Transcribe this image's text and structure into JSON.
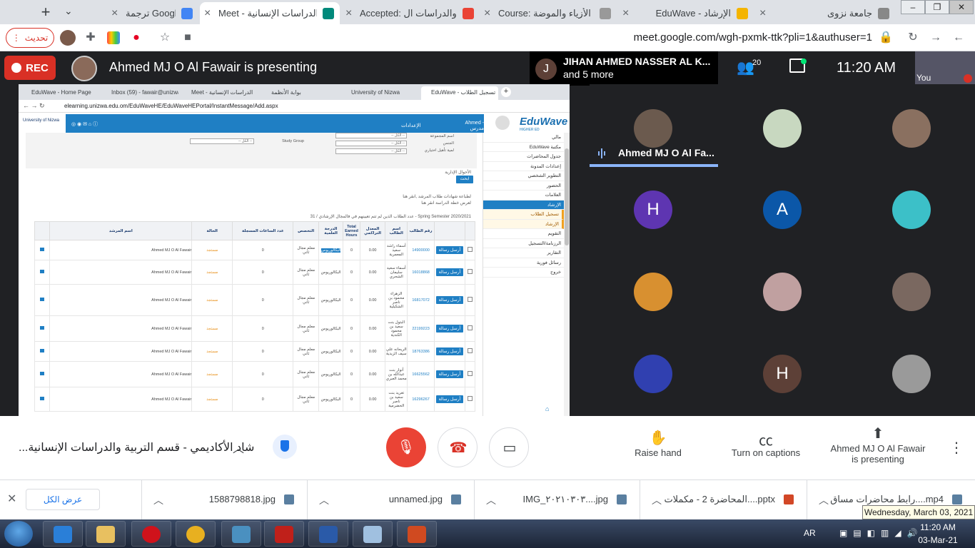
{
  "browser": {
    "tabs": [
      {
        "title": "ترجمة Google",
        "icon": "google-translate-icon",
        "active": false
      },
      {
        "title": "Meet - الدراسات الإنسانية",
        "icon": "google-meet-icon",
        "active": true
      },
      {
        "title": "Accepted: التربية والدراسات ال",
        "icon": "gmail-icon",
        "active": false
      },
      {
        "title": "Course: ملات الأزياء والموضة",
        "icon": "moodle-icon",
        "active": false
      },
      {
        "title": "EduWave - الإرشاد",
        "icon": "eduwave-icon",
        "active": false
      },
      {
        "title": "جامعة نزوى",
        "icon": "university-icon",
        "active": false
      }
    ],
    "update_label": "تحديث",
    "url": "meet.google.com/wgh-pxmk-ttk?pli=1&authuser=1"
  },
  "meet": {
    "rec_label": "REC",
    "presenting_text": "Ahmed MJ O Al Fawair is presenting",
    "notification": {
      "initial": "J",
      "name": "JIHAN AHMED NASSER AL K...",
      "more": "and 5 more"
    },
    "participant_count": "20",
    "time": "11:20 AM",
    "self_label": "You",
    "meeting_title": "...شاد الأكاديمي - قسم التربية والدراسات الإنسانية",
    "speaker_name": "Ahmed MJ O Al Fa...",
    "tiles": [
      {
        "type": "photo",
        "color": "#6b5a4e"
      },
      {
        "type": "photo",
        "color": "#c8d8c0"
      },
      {
        "type": "photo",
        "color": "#8a7060"
      },
      {
        "type": "letter",
        "letter": "H",
        "color": "#5e35b1"
      },
      {
        "type": "letter",
        "letter": "A",
        "color": "#0b57a8"
      },
      {
        "type": "photo",
        "color": "#3cc0c8"
      },
      {
        "type": "photo",
        "color": "#d89030"
      },
      {
        "type": "photo",
        "color": "#c0a0a0"
      },
      {
        "type": "photo",
        "color": "#7a6860"
      },
      {
        "type": "photo",
        "color": "#3040b0"
      },
      {
        "type": "letter",
        "letter": "H",
        "color": "#5d4037"
      },
      {
        "type": "photo",
        "color": "#9a9a9a"
      }
    ],
    "controls": {
      "raise_hand": "Raise hand",
      "captions": "Turn on captions",
      "presenting_line1": "Ahmed MJ O Al Fawair",
      "presenting_line2": "is presenting"
    }
  },
  "presented": {
    "tabs": [
      "EduWave - Home Page",
      "Inbox (59) - fawair@unizwa",
      "Meet - الدراسات الإنسانية",
      "بوابة الأنظمة",
      "University of Nizwa",
      "EduWave - تسجيل الطلاب"
    ],
    "url": "elearning.unizwa.edu.om/EduWaveHE/EduWaveHEPortal/InstantMessage/Add.aspx",
    "header_right": "Ahmed - مدرس",
    "header_settings": "الإعدادات",
    "logo_left": "University of Nizwa",
    "logo": "EduWave",
    "logo_sub": "HIGHER ED",
    "sidebar": [
      {
        "label": "مالي",
        "state": "normal"
      },
      {
        "label": "EduWave مكتبة",
        "state": "chev"
      },
      {
        "label": "جدول المحاضرات",
        "state": "normal"
      },
      {
        "label": "إعدادات المدونة",
        "state": "chev"
      },
      {
        "label": "التطوير الشخصي",
        "state": "normal"
      },
      {
        "label": "الحضور",
        "state": "normal"
      },
      {
        "label": "العلامات",
        "state": "normal"
      },
      {
        "label": "الإرشاد",
        "state": "on"
      },
      {
        "label": "تسجيل الطلاب",
        "state": "sub"
      },
      {
        "label": "الإرشاد",
        "state": "sub"
      },
      {
        "label": "التقويم",
        "state": "normal"
      },
      {
        "label": "الرزنامة/التسجيل",
        "state": "normal"
      },
      {
        "label": "التقارير",
        "state": "chev"
      },
      {
        "label": "رسائل فورية",
        "state": "chev"
      },
      {
        "label": "خروج",
        "state": "normal"
      }
    ],
    "filters": {
      "study_group": "Study Group",
      "labels": [
        "اسم المجموعة",
        "الجنس",
        "لمية تأهيل اختياري"
      ],
      "select_placeholder": "-- الكل --"
    },
    "search_label": "ابحث",
    "note_top": "الأحوال الإدارية",
    "note1": "لطباعة شهادات طلاب المرشد ,انقر هنا",
    "note2": "لعرض خطة الدراسة انقر هنا",
    "summary": "عدد الطلاب الذين لم تتم تعيينهم في فالمجال الإرشادي / 31 - Spring Semester 2020/2021",
    "table": {
      "headers": [
        "",
        "",
        "رقم الطالب",
        "اسم الطالب",
        "المعدل التراكمي",
        "Total Earned Hours",
        "الدرجة العلمية",
        "التخصص",
        "عدد الساعات المسجلة",
        "الحالة",
        "اسم المرشد",
        ""
      ],
      "send_label": "أرسل رسالة",
      "rows": [
        {
          "id": "14900000",
          "name": "أسماء راشد سعيد المعمرية",
          "gpa": "0.00",
          "hours": "0",
          "degree": "البكالوريوس",
          "major": "معلم مجال ثاني",
          "reg": "0",
          "status": "مستجد",
          "advisor": "Ahmed MJ O Al Fawair"
        },
        {
          "id": "16018868",
          "name": "أسماء سعيد سليمان الشحري",
          "gpa": "0.00",
          "hours": "0",
          "degree": "البكالوريوس",
          "major": "معلم مجال ثاني",
          "reg": "0",
          "status": "مستجد",
          "advisor": "Ahmed MJ O Al Fawair"
        },
        {
          "id": "16817072",
          "name": "الزهراء محمود بن ناصر الشكيلية",
          "gpa": "0.00",
          "hours": "0",
          "degree": "البكالوريوس",
          "major": "معلم مجال ثاني",
          "reg": "0",
          "status": "مستجد",
          "advisor": "Ahmed MJ O Al Fawair"
        },
        {
          "id": "22199223",
          "name": "البتول بنت سعيد بن محمود الكندية",
          "gpa": "0.00",
          "hours": "0",
          "degree": "البكالوريوس",
          "major": "معلم مجال ثاني",
          "reg": "0",
          "status": "مستجد",
          "advisor": "Ahmed MJ O Al Fawair"
        },
        {
          "id": "18763386",
          "name": "الريحانه علي سيف الزيدية",
          "gpa": "0.00",
          "hours": "0",
          "degree": "البكالوريوس",
          "major": "معلم مجال ثاني",
          "reg": "0",
          "status": "مستجد",
          "advisor": "Ahmed MJ O Al Fawair"
        },
        {
          "id": "16625562",
          "name": "أنوار بنت عبدالله بن محمد العبري",
          "gpa": "0.00",
          "hours": "0",
          "degree": "البكالوريوس",
          "major": "معلم مجال ثاني",
          "reg": "0",
          "status": "مستجد",
          "advisor": "Ahmed MJ O Al Fawair"
        },
        {
          "id": "16296267",
          "name": "تغريد بنت سعيد بن ناصر الحضرمية",
          "gpa": "0.00",
          "hours": "0",
          "degree": "البكالوريوس",
          "major": "معلم مجال ثاني",
          "reg": "0",
          "status": "مستجد",
          "advisor": "Ahmed MJ O Al Fawair"
        }
      ]
    }
  },
  "downloads": {
    "show_all": "عرض الكل",
    "items": [
      {
        "name": "1588798818.jpg",
        "icon": "image-file-icon",
        "color": "#5a7fa0"
      },
      {
        "name": "unnamed.jpg",
        "icon": "image-file-icon",
        "color": "#5a7fa0"
      },
      {
        "name": "IMG_٢٠٢١٠٣٠٣....jpg",
        "icon": "image-file-icon",
        "color": "#5a7fa0"
      },
      {
        "name": "المحاضرة 2 - مكملات....pptx",
        "icon": "pptx-file-icon",
        "color": "#d24726"
      },
      {
        "name": "رابط محاضرات مساق....mp4",
        "icon": "video-file-icon",
        "color": "#5a7fa0"
      }
    ],
    "tooltip": "Wednesday, March 03, 2021"
  },
  "taskbar": {
    "apps": [
      {
        "name": "internet-explorer-icon",
        "color": "#2a7fd8"
      },
      {
        "name": "file-explorer-icon",
        "color": "#e8c060"
      },
      {
        "name": "opera-icon",
        "color": "#d0121b"
      },
      {
        "name": "chrome-icon",
        "color": "#e8b020"
      },
      {
        "name": "image-viewer-icon",
        "color": "#4a90c0"
      },
      {
        "name": "acrobat-icon",
        "color": "#c0201a"
      },
      {
        "name": "word-icon",
        "color": "#2a5aa8"
      },
      {
        "name": "paint-icon",
        "color": "#a0c0e0"
      },
      {
        "name": "powerpoint-icon",
        "color": "#d04a20"
      }
    ],
    "lang": "AR",
    "time": "11:20 AM",
    "date": "03-Mar-21"
  }
}
